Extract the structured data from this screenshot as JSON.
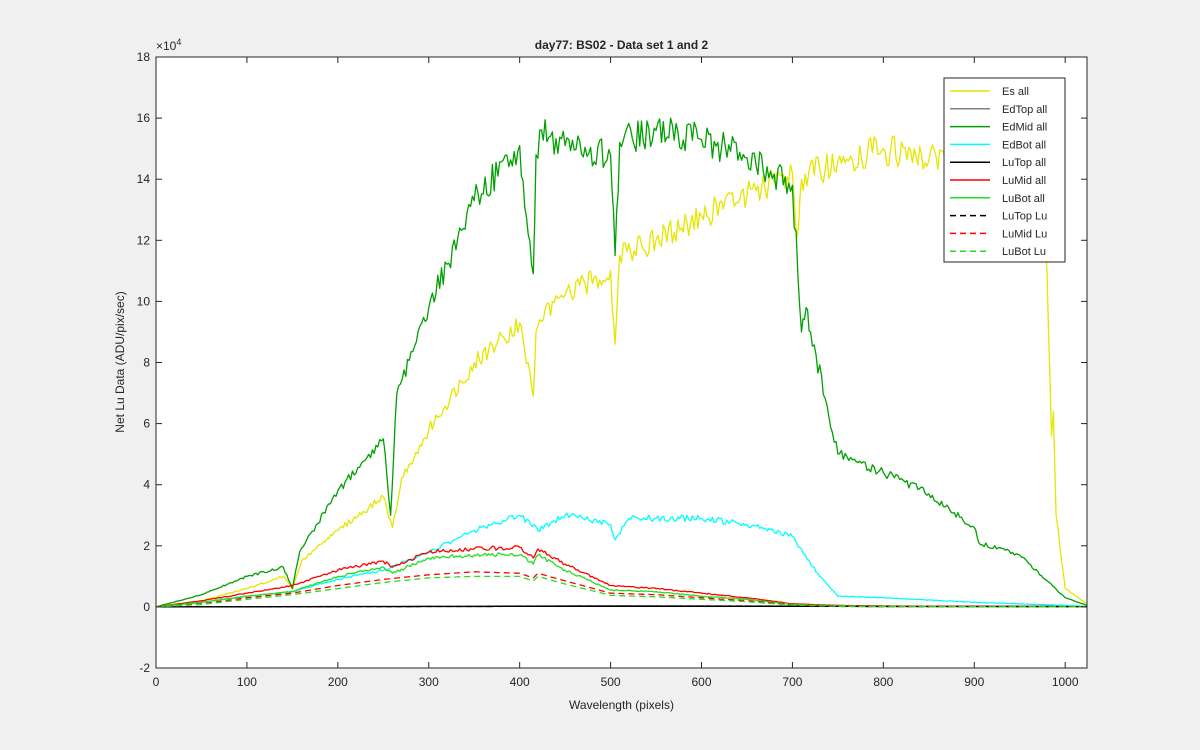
{
  "chart_data": {
    "type": "line",
    "title": "day77: BS02 - Data set 1 and 2",
    "xlabel": "Wavelength (pixels)",
    "ylabel": "Net Lu Data (ADU/pix/sec)",
    "y_exponent_label": "×10",
    "y_exponent": "4",
    "xlim": [
      0,
      1024
    ],
    "ylim": [
      -2,
      18
    ],
    "y_scale_factor": 10000,
    "xticks": [
      0,
      100,
      200,
      300,
      400,
      500,
      600,
      700,
      800,
      900,
      1000
    ],
    "yticks": [
      -2,
      0,
      2,
      4,
      6,
      8,
      10,
      12,
      14,
      16,
      18
    ],
    "grid": false,
    "legend_position": "top-right",
    "series": [
      {
        "name": "Es  all",
        "color": "#e6e600",
        "dash": "solid",
        "x": [
          0,
          50,
          100,
          140,
          150,
          160,
          200,
          250,
          260,
          270,
          300,
          350,
          400,
          415,
          418,
          422,
          450,
          500,
          505,
          510,
          550,
          600,
          650,
          700,
          705,
          710,
          750,
          800,
          850,
          900,
          920,
          950,
          970,
          980,
          985,
          987,
          990,
          1000,
          1024
        ],
        "y": [
          0,
          0.2,
          0.6,
          1.0,
          0.6,
          1.5,
          2.5,
          3.6,
          2.6,
          4.2,
          5.8,
          8.0,
          9.3,
          6.9,
          9.0,
          9.4,
          10.2,
          11.0,
          8.6,
          11.5,
          12.0,
          12.8,
          13.5,
          14.2,
          12.1,
          14.0,
          14.6,
          15.0,
          14.6,
          14.8,
          14.5,
          14.3,
          13.5,
          11.0,
          5.6,
          6.4,
          3.0,
          0.6,
          0.1
        ]
      },
      {
        "name": "EdTop  all",
        "color": "#7f7f7f",
        "dash": "solid",
        "x": [
          0,
          500,
          1024
        ],
        "y": [
          0,
          0.04,
          0.02
        ]
      },
      {
        "name": "EdMid  all",
        "color": "#00a000",
        "dash": "solid",
        "x": [
          0,
          50,
          100,
          140,
          150,
          158,
          200,
          250,
          258,
          265,
          300,
          350,
          400,
          415,
          418,
          422,
          450,
          500,
          505,
          510,
          550,
          600,
          650,
          700,
          710,
          715,
          720,
          750,
          800,
          850,
          900,
          905,
          950,
          1000,
          1024
        ],
        "y": [
          0,
          0.4,
          1.0,
          1.3,
          0.6,
          1.8,
          3.8,
          5.5,
          3.0,
          7.0,
          9.8,
          13.3,
          15.1,
          10.9,
          14.8,
          15.6,
          15.1,
          14.8,
          11.5,
          15.2,
          15.6,
          15.3,
          14.7,
          13.8,
          9.0,
          9.8,
          9.0,
          5.0,
          4.4,
          3.7,
          2.6,
          2.1,
          1.7,
          0.3,
          0.05
        ]
      },
      {
        "name": "EdBot  all",
        "color": "#00ffff",
        "dash": "solid",
        "x": [
          0,
          50,
          100,
          150,
          200,
          250,
          300,
          350,
          400,
          420,
          450,
          500,
          505,
          520,
          550,
          600,
          650,
          700,
          730,
          750,
          800,
          900,
          1000,
          1024
        ],
        "y": [
          0,
          0.15,
          0.35,
          0.5,
          0.9,
          1.2,
          1.8,
          2.5,
          3.0,
          2.5,
          3.0,
          2.7,
          2.2,
          2.9,
          2.9,
          2.9,
          2.7,
          2.3,
          1.0,
          0.35,
          0.3,
          0.15,
          0.05,
          0.02
        ]
      },
      {
        "name": "LuTop  all",
        "color": "#000000",
        "dash": "solid",
        "x": [
          0,
          500,
          1024
        ],
        "y": [
          0,
          0.02,
          0.01
        ]
      },
      {
        "name": "LuMid  all",
        "color": "#ff0000",
        "dash": "solid",
        "x": [
          0,
          50,
          100,
          150,
          200,
          250,
          260,
          300,
          350,
          400,
          415,
          420,
          450,
          500,
          550,
          600,
          650,
          700,
          750,
          800,
          900,
          1024
        ],
        "y": [
          0,
          0.2,
          0.45,
          0.7,
          1.2,
          1.5,
          1.3,
          1.8,
          1.9,
          1.95,
          1.6,
          1.9,
          1.4,
          0.7,
          0.6,
          0.45,
          0.3,
          0.1,
          0.05,
          0.03,
          0.02,
          0.01
        ]
      },
      {
        "name": "LuBot  all",
        "color": "#22dd22",
        "dash": "solid",
        "x": [
          0,
          50,
          100,
          150,
          200,
          250,
          260,
          300,
          350,
          400,
          415,
          420,
          450,
          500,
          550,
          600,
          650,
          700,
          750,
          800,
          900,
          1024
        ],
        "y": [
          0,
          0.15,
          0.35,
          0.5,
          1.0,
          1.3,
          1.1,
          1.6,
          1.7,
          1.7,
          1.4,
          1.7,
          1.2,
          0.55,
          0.5,
          0.35,
          0.25,
          0.08,
          0.04,
          0.02,
          0.01,
          0.0
        ]
      },
      {
        "name": "LuTop  Lu",
        "color": "#000000",
        "dash": "dashed",
        "x": [
          0,
          500,
          1024
        ],
        "y": [
          0,
          0.02,
          0.01
        ]
      },
      {
        "name": "LuMid  Lu",
        "color": "#ff0000",
        "dash": "dashed",
        "x": [
          0,
          50,
          100,
          150,
          200,
          250,
          300,
          350,
          400,
          415,
          420,
          450,
          500,
          550,
          600,
          650,
          700,
          750,
          800,
          1024
        ],
        "y": [
          0,
          0.1,
          0.3,
          0.45,
          0.7,
          0.9,
          1.05,
          1.15,
          1.1,
          0.95,
          1.1,
          0.85,
          0.45,
          0.4,
          0.3,
          0.2,
          0.07,
          0.03,
          0.01,
          0.0
        ]
      },
      {
        "name": "LuBot  Lu",
        "color": "#22dd22",
        "dash": "dashed",
        "x": [
          0,
          50,
          100,
          150,
          200,
          250,
          300,
          350,
          400,
          415,
          420,
          450,
          500,
          550,
          600,
          650,
          700,
          750,
          800,
          1024
        ],
        "y": [
          0,
          0.08,
          0.25,
          0.4,
          0.6,
          0.8,
          0.95,
          1.0,
          1.0,
          0.85,
          1.0,
          0.75,
          0.38,
          0.33,
          0.25,
          0.17,
          0.06,
          0.02,
          0.01,
          0.0
        ]
      }
    ]
  }
}
